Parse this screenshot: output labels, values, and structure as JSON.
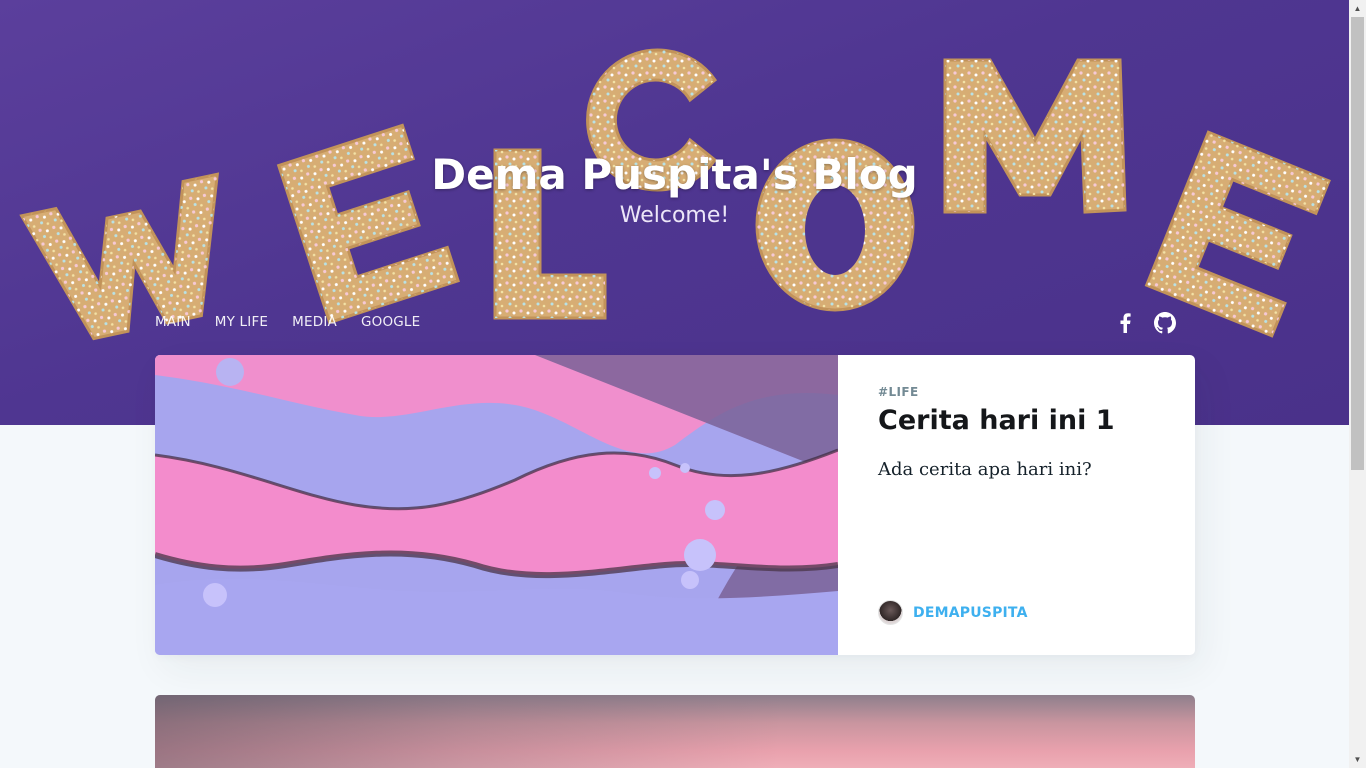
{
  "hero": {
    "title": "Dema Puspita's Blog",
    "subtitle": "Welcome!",
    "background_color": "#4f3691"
  },
  "nav": {
    "items": [
      {
        "label": "MAIN"
      },
      {
        "label": "MY LIFE"
      },
      {
        "label": "MEDIA"
      },
      {
        "label": "GOOGLE"
      }
    ]
  },
  "social": {
    "icons": [
      "facebook-icon",
      "github-icon"
    ]
  },
  "posts": [
    {
      "tag": "#LIFE",
      "title": "Cerita hari ini 1",
      "excerpt": "Ada cerita apa hari ini?",
      "author": "DEMAPUSPITA",
      "image": "pink-purple-fluid-art"
    },
    {
      "image": "pink-sky-gradient"
    }
  ],
  "colors": {
    "accent": "#3eb0ef",
    "tag": "#738a94",
    "page_background": "#f4f8fb"
  }
}
